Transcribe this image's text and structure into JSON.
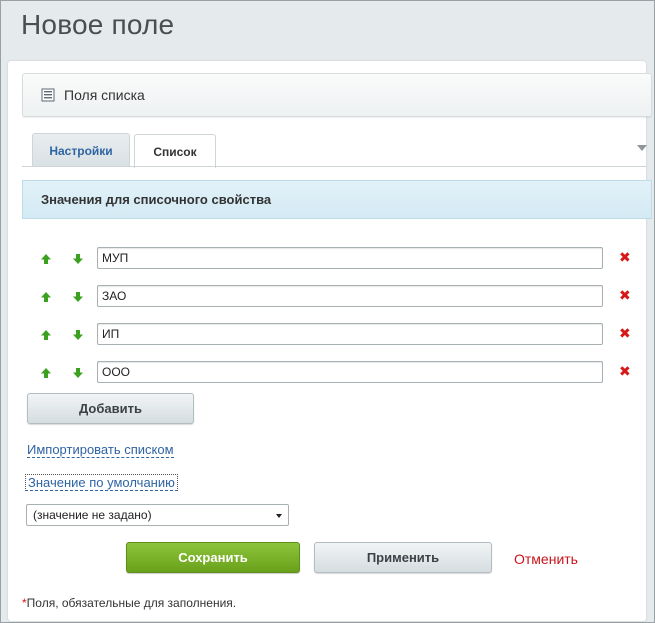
{
  "page": {
    "title": "Новое поле"
  },
  "list_fields_bar": {
    "icon": "list-icon",
    "label": "Поля списка"
  },
  "tabs": [
    {
      "label": "Настройки",
      "active": false
    },
    {
      "label": "Список",
      "active": true
    }
  ],
  "section": {
    "title": "Значения для списочного свойства"
  },
  "values": [
    {
      "value": "МУП"
    },
    {
      "value": "ЗАО"
    },
    {
      "value": "ИП"
    },
    {
      "value": "ООО"
    }
  ],
  "row_icons": {
    "up": "arrow-up-icon",
    "down": "arrow-down-icon",
    "delete": "delete-icon",
    "delete_glyph": "✖"
  },
  "add_button": {
    "label": "Добавить"
  },
  "links": {
    "import": "Импортировать списком",
    "default_value": "Значение по умолчанию"
  },
  "default_select": {
    "value": "(значение не задано)"
  },
  "actions": {
    "save": "Сохранить",
    "apply": "Применить",
    "cancel": "Отменить"
  },
  "footer": {
    "star": "*",
    "note": "Поля, обязательные для заполнения."
  },
  "colors": {
    "accent_green": "#6aa11b",
    "link_blue": "#2f64a3",
    "cancel_red": "#c8141b",
    "arrow_green": "#3ca020",
    "section_blue": "#d3eaf4"
  }
}
